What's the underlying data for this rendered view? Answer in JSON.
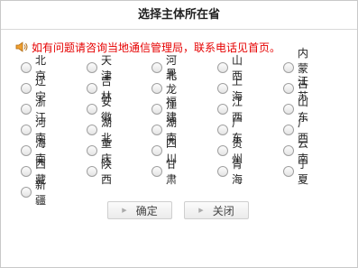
{
  "dialog": {
    "title": "选择主体所在省",
    "notice": "如有问题请咨询当地通信管理局，联系电话见首页。",
    "provinces": [
      [
        "北京",
        "天津",
        "河北",
        "山西",
        "内蒙古"
      ],
      [
        "辽宁",
        "吉林",
        "黑龙江",
        "上海",
        "江苏"
      ],
      [
        "浙江",
        "安徽",
        "福建",
        "江西",
        "山东"
      ],
      [
        "河南",
        "湖北",
        "湖南",
        "广东",
        "广西"
      ],
      [
        "海南",
        "重庆",
        "四川",
        "贵州",
        "云南"
      ],
      [
        "西藏",
        "陕西",
        "甘肃",
        "青海",
        "宁夏"
      ],
      [
        "新疆"
      ]
    ],
    "confirm_label": "确定",
    "close_label": "关闭"
  },
  "colors": {
    "notice": "#e60000",
    "border": "#c9c9c9"
  },
  "icons": {
    "notice_icon": "speaker-icon"
  }
}
